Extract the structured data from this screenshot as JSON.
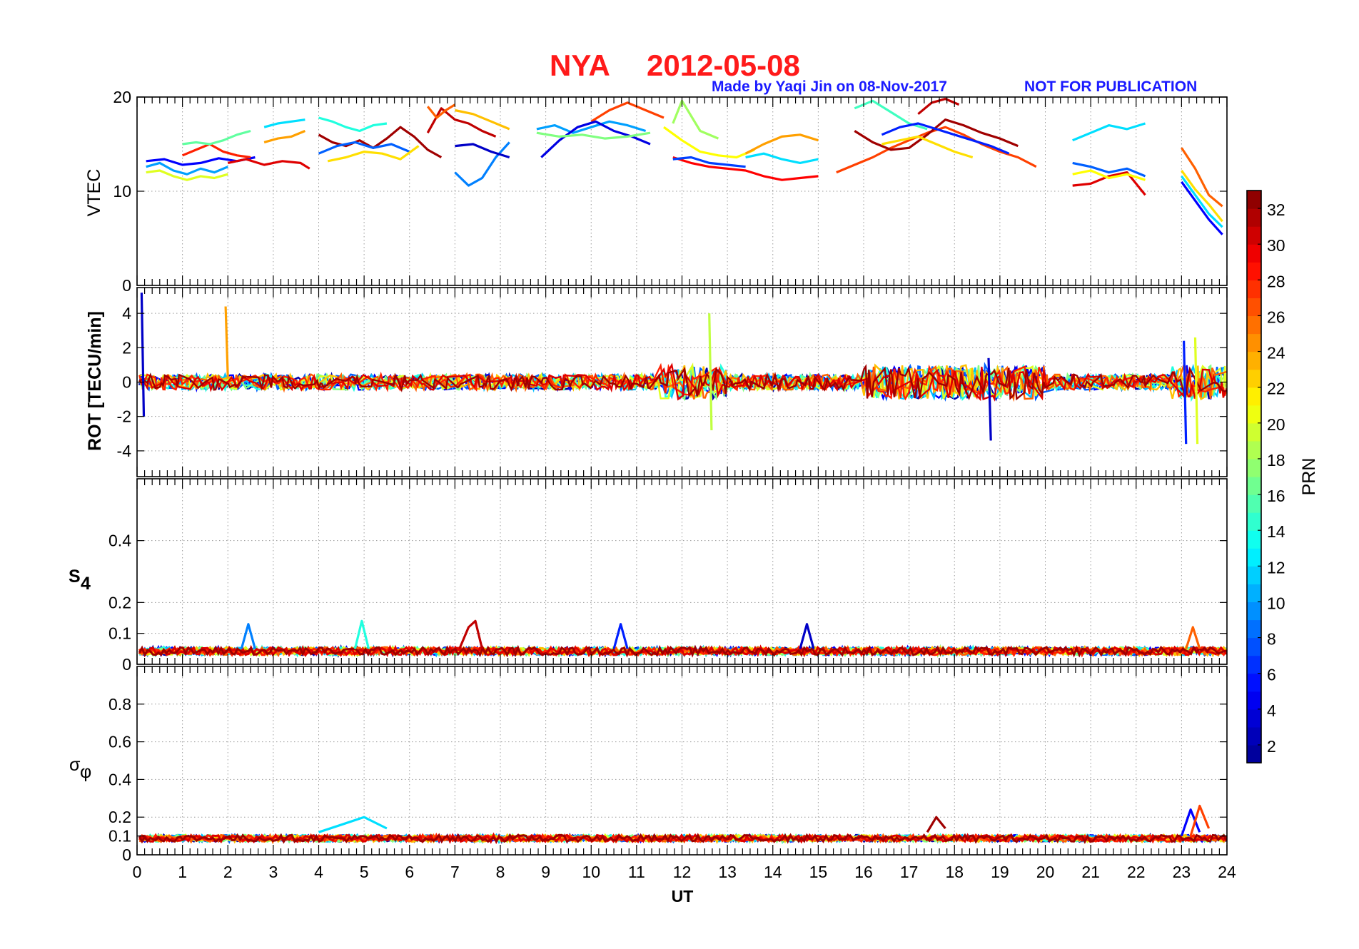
{
  "title": {
    "station": "NYA",
    "date": "2012-05-08"
  },
  "credit": {
    "made_by": "Made by Yaqi Jin on 08-Nov-2017",
    "notice": "NOT FOR PUBLICATION"
  },
  "xaxis": {
    "label": "UT",
    "range": [
      0,
      24
    ],
    "ticks": [
      "0",
      "1",
      "2",
      "3",
      "4",
      "5",
      "6",
      "7",
      "8",
      "9",
      "10",
      "11",
      "12",
      "13",
      "14",
      "15",
      "16",
      "17",
      "18",
      "19",
      "20",
      "21",
      "22",
      "23",
      "24"
    ]
  },
  "colorbar": {
    "label": "PRN",
    "range": [
      1,
      33
    ],
    "ticks": [
      "2",
      "4",
      "6",
      "8",
      "10",
      "12",
      "14",
      "16",
      "18",
      "20",
      "22",
      "24",
      "26",
      "28",
      "30",
      "32"
    ],
    "colormap": [
      "#00008f",
      "#0000ff",
      "#0080ff",
      "#00ffff",
      "#80ff80",
      "#ffff00",
      "#ff8000",
      "#ff0000",
      "#800000"
    ]
  },
  "chart_data": [
    {
      "type": "line",
      "panel": "VTEC",
      "ylabel": "VTEC",
      "ylim": [
        0,
        20
      ],
      "yticks": [
        "0",
        "10",
        "20"
      ],
      "grid": true,
      "series": [
        {
          "prn": 5,
          "x": [
            0.2,
            0.6,
            1.0,
            1.4,
            1.8,
            2.2,
            2.6
          ],
          "y": [
            13.2,
            13.4,
            12.8,
            13.0,
            13.5,
            13.2,
            13.6
          ]
        },
        {
          "prn": 10,
          "x": [
            0.2,
            0.5,
            0.8,
            1.1,
            1.4,
            1.7,
            2.0
          ],
          "y": [
            12.6,
            13.0,
            12.2,
            11.8,
            12.4,
            12.0,
            12.6
          ]
        },
        {
          "prn": 20,
          "x": [
            0.2,
            0.5,
            0.8,
            1.1,
            1.4,
            1.7,
            2.0
          ],
          "y": [
            12.0,
            12.2,
            11.6,
            11.2,
            11.6,
            11.4,
            11.8
          ]
        },
        {
          "prn": 28,
          "x": [
            1.0,
            1.3,
            1.6,
            1.9,
            2.2,
            2.5
          ],
          "y": [
            13.8,
            14.4,
            15.0,
            14.2,
            13.8,
            13.6
          ]
        },
        {
          "prn": 16,
          "x": [
            1.0,
            1.3,
            1.6,
            1.9,
            2.2,
            2.5
          ],
          "y": [
            15.0,
            15.2,
            15.0,
            15.4,
            16.0,
            16.4
          ]
        },
        {
          "prn": 30,
          "x": [
            2.0,
            2.4,
            2.8,
            3.2,
            3.6,
            3.8
          ],
          "y": [
            13.0,
            13.4,
            12.8,
            13.2,
            13.0,
            12.4
          ]
        },
        {
          "prn": 12,
          "x": [
            2.8,
            3.1,
            3.4,
            3.7
          ],
          "y": [
            16.8,
            17.2,
            17.4,
            17.6
          ]
        },
        {
          "prn": 24,
          "x": [
            2.8,
            3.1,
            3.4,
            3.7
          ],
          "y": [
            15.2,
            15.6,
            15.8,
            16.4
          ]
        },
        {
          "prn": 32,
          "x": [
            4.0,
            4.3,
            4.6,
            4.9,
            5.2,
            5.5,
            5.8,
            6.1,
            6.4,
            6.7
          ],
          "y": [
            16.0,
            15.2,
            14.8,
            15.4,
            14.6,
            15.6,
            16.8,
            15.8,
            14.4,
            13.6
          ]
        },
        {
          "prn": 14,
          "x": [
            4.0,
            4.3,
            4.6,
            4.9,
            5.2,
            5.5
          ],
          "y": [
            17.8,
            17.4,
            16.8,
            16.4,
            17.0,
            17.2
          ]
        },
        {
          "prn": 8,
          "x": [
            4.0,
            4.4,
            4.8,
            5.2,
            5.6,
            6.0
          ],
          "y": [
            14.0,
            14.8,
            15.2,
            14.6,
            15.0,
            14.2
          ]
        },
        {
          "prn": 22,
          "x": [
            4.2,
            4.6,
            5.0,
            5.4,
            5.8,
            6.2
          ],
          "y": [
            13.2,
            13.6,
            14.2,
            14.0,
            13.4,
            14.8
          ]
        },
        {
          "prn": 31,
          "x": [
            6.4,
            6.7,
            7.0,
            7.3,
            7.6,
            7.9
          ],
          "y": [
            16.2,
            18.8,
            17.6,
            17.2,
            16.4,
            15.8
          ]
        },
        {
          "prn": 26,
          "x": [
            6.4,
            6.6,
            6.8,
            7.0
          ],
          "y": [
            19.0,
            17.8,
            18.6,
            19.2
          ]
        },
        {
          "prn": 9,
          "x": [
            7.0,
            7.3,
            7.6,
            7.9,
            8.2
          ],
          "y": [
            12.0,
            10.6,
            11.4,
            13.6,
            15.2
          ]
        },
        {
          "prn": 3,
          "x": [
            7.0,
            7.4,
            7.8,
            8.2
          ],
          "y": [
            14.8,
            15.0,
            14.2,
            13.6
          ]
        },
        {
          "prn": 23,
          "x": [
            7.0,
            7.4,
            7.8,
            8.2
          ],
          "y": [
            18.6,
            18.2,
            17.4,
            16.6
          ]
        },
        {
          "prn": 10,
          "x": [
            8.8,
            9.2,
            9.6,
            10.0,
            10.4,
            10.8,
            11.2
          ],
          "y": [
            16.6,
            17.0,
            16.2,
            16.8,
            17.4,
            17.0,
            16.4
          ]
        },
        {
          "prn": 27,
          "x": [
            10.0,
            10.4,
            10.8,
            11.2,
            11.6
          ],
          "y": [
            17.4,
            18.6,
            19.4,
            18.6,
            17.8
          ]
        },
        {
          "prn": 4,
          "x": [
            8.9,
            9.3,
            9.7,
            10.1,
            10.5,
            10.9,
            11.3
          ],
          "y": [
            13.6,
            15.4,
            16.8,
            17.4,
            16.4,
            15.8,
            15.0
          ]
        },
        {
          "prn": 17,
          "x": [
            8.8,
            9.3,
            9.8,
            10.3,
            10.8,
            11.3
          ],
          "y": [
            16.2,
            15.8,
            16.0,
            15.6,
            15.8,
            16.2
          ]
        },
        {
          "prn": 21,
          "x": [
            11.6,
            12.0,
            12.4,
            12.8,
            13.2,
            13.6
          ],
          "y": [
            16.8,
            15.4,
            14.2,
            13.8,
            13.6,
            14.4
          ]
        },
        {
          "prn": 18,
          "x": [
            11.8,
            12.0,
            12.4,
            12.8
          ],
          "y": [
            17.2,
            19.6,
            16.4,
            15.6
          ]
        },
        {
          "prn": 29,
          "x": [
            11.8,
            12.2,
            12.6,
            13.0,
            13.4,
            13.8,
            14.2,
            14.6,
            15.0
          ],
          "y": [
            13.6,
            13.0,
            12.6,
            12.4,
            12.2,
            11.6,
            11.2,
            11.4,
            11.6
          ]
        },
        {
          "prn": 7,
          "x": [
            11.8,
            12.2,
            12.6,
            13.0,
            13.4
          ],
          "y": [
            13.4,
            13.6,
            13.0,
            12.8,
            12.6
          ]
        },
        {
          "prn": 24,
          "x": [
            13.4,
            13.8,
            14.2,
            14.6,
            15.0
          ],
          "y": [
            14.0,
            15.0,
            15.8,
            16.0,
            15.4
          ]
        },
        {
          "prn": 12,
          "x": [
            13.4,
            13.8,
            14.2,
            14.6,
            15.0
          ],
          "y": [
            13.6,
            14.0,
            13.4,
            13.0,
            13.4
          ]
        },
        {
          "prn": 27,
          "x": [
            15.4,
            15.8,
            16.2,
            16.6,
            17.0,
            17.4,
            17.8,
            18.2,
            18.6,
            19.0,
            19.4,
            19.8
          ],
          "y": [
            12.0,
            12.8,
            13.6,
            14.6,
            15.4,
            16.2,
            16.8,
            16.0,
            15.0,
            14.2,
            13.6,
            12.6
          ]
        },
        {
          "prn": 15,
          "x": [
            15.8,
            16.2,
            16.6,
            17.0,
            17.4
          ],
          "y": [
            18.8,
            19.6,
            18.4,
            17.2,
            16.6
          ]
        },
        {
          "prn": 32,
          "x": [
            15.8,
            16.2,
            16.6,
            17.0,
            17.4,
            17.8,
            18.2,
            18.6,
            19.0,
            19.4
          ],
          "y": [
            16.4,
            15.2,
            14.4,
            14.6,
            16.0,
            17.6,
            17.0,
            16.2,
            15.6,
            14.8
          ]
        },
        {
          "prn": 31,
          "x": [
            17.2,
            17.5,
            17.8,
            18.1
          ],
          "y": [
            18.2,
            19.4,
            19.8,
            19.2
          ]
        },
        {
          "prn": 6,
          "x": [
            16.4,
            16.8,
            17.2,
            17.6,
            18.0,
            18.4,
            18.8,
            19.2
          ],
          "y": [
            16.0,
            16.8,
            17.2,
            16.6,
            16.0,
            15.4,
            14.8,
            14.0
          ]
        },
        {
          "prn": 22,
          "x": [
            16.4,
            16.8,
            17.2,
            17.6,
            18.0,
            18.4
          ],
          "y": [
            15.0,
            15.4,
            15.8,
            15.0,
            14.2,
            13.6
          ]
        },
        {
          "prn": 12,
          "x": [
            20.6,
            21.0,
            21.4,
            21.8,
            22.2
          ],
          "y": [
            15.4,
            16.2,
            17.0,
            16.6,
            17.2
          ]
        },
        {
          "prn": 30,
          "x": [
            20.6,
            21.0,
            21.4,
            21.8,
            22.2
          ],
          "y": [
            10.6,
            10.8,
            11.6,
            12.0,
            9.6
          ]
        },
        {
          "prn": 8,
          "x": [
            20.6,
            21.0,
            21.4,
            21.8,
            22.2
          ],
          "y": [
            13.0,
            12.6,
            12.0,
            12.4,
            11.6
          ]
        },
        {
          "prn": 21,
          "x": [
            20.6,
            21.0,
            21.4,
            21.8,
            22.2
          ],
          "y": [
            11.8,
            12.2,
            11.4,
            11.8,
            11.2
          ]
        },
        {
          "prn": 5,
          "x": [
            23.0,
            23.3,
            23.6,
            23.9
          ],
          "y": [
            11.0,
            9.0,
            7.0,
            5.4
          ]
        },
        {
          "prn": 12,
          "x": [
            23.0,
            23.3,
            23.6,
            23.9
          ],
          "y": [
            11.6,
            9.6,
            7.6,
            6.2
          ]
        },
        {
          "prn": 22,
          "x": [
            23.0,
            23.3,
            23.6,
            23.9
          ],
          "y": [
            12.2,
            10.2,
            8.6,
            6.8
          ]
        },
        {
          "prn": 26,
          "x": [
            23.0,
            23.3,
            23.6,
            23.9
          ],
          "y": [
            14.6,
            12.4,
            9.6,
            8.4
          ]
        }
      ]
    },
    {
      "type": "line",
      "panel": "ROT",
      "ylabel": "ROT [TECU/min]",
      "ylim": [
        -5.5,
        5.5
      ],
      "yticks": [
        "-4",
        "-2",
        "0",
        "2",
        "4"
      ],
      "grid": true,
      "note": "high-frequency noise around 0 TECU/min with spikes",
      "series": [
        {
          "prn": 3,
          "x": [
            0.1,
            0.15
          ],
          "y": [
            5.2,
            -2.0
          ]
        },
        {
          "prn": 24,
          "x": [
            1.95,
            2.0
          ],
          "y": [
            4.4,
            0.2
          ]
        },
        {
          "prn": 19,
          "x": [
            12.6,
            12.65
          ],
          "y": [
            4.0,
            -2.8
          ]
        },
        {
          "prn": 3,
          "x": [
            18.75,
            18.8
          ],
          "y": [
            1.4,
            -3.4
          ]
        },
        {
          "prn": 6,
          "x": [
            23.05,
            23.1
          ],
          "y": [
            2.4,
            -3.6
          ]
        },
        {
          "prn": 20,
          "x": [
            23.3,
            23.35
          ],
          "y": [
            2.6,
            -3.6
          ]
        }
      ]
    },
    {
      "type": "line",
      "panel": "S4",
      "ylabel": "S4",
      "ylim": [
        0,
        0.6
      ],
      "yticks": [
        "0",
        "0.1",
        "0.2",
        "0.4"
      ],
      "grid": true,
      "series": [
        {
          "prn": 31,
          "x": [
            7.1,
            7.3,
            7.45,
            7.6
          ],
          "y": [
            0.05,
            0.12,
            0.14,
            0.05
          ]
        },
        {
          "prn": 9,
          "x": [
            2.3,
            2.45,
            2.6
          ],
          "y": [
            0.05,
            0.13,
            0.05
          ]
        },
        {
          "prn": 14,
          "x": [
            4.8,
            4.95,
            5.1
          ],
          "y": [
            0.05,
            0.14,
            0.05
          ]
        },
        {
          "prn": 6,
          "x": [
            10.5,
            10.65,
            10.8
          ],
          "y": [
            0.05,
            0.13,
            0.05
          ]
        },
        {
          "prn": 3,
          "x": [
            14.6,
            14.75,
            14.9
          ],
          "y": [
            0.05,
            0.13,
            0.05
          ]
        },
        {
          "prn": 26,
          "x": [
            23.1,
            23.25,
            23.4
          ],
          "y": [
            0.05,
            0.12,
            0.05
          ]
        }
      ]
    },
    {
      "type": "line",
      "panel": "sigma_phi",
      "ylabel": "σφ",
      "ylim": [
        0,
        1.0
      ],
      "yticks": [
        "0",
        "0.1",
        "0.2",
        "0.4",
        "0.6",
        "0.8"
      ],
      "grid": true,
      "series": [
        {
          "prn": 12,
          "x": [
            4.0,
            4.5,
            5.0,
            5.5
          ],
          "y": [
            0.12,
            0.16,
            0.2,
            0.14
          ]
        },
        {
          "prn": 5,
          "x": [
            23.0,
            23.2,
            23.4
          ],
          "y": [
            0.1,
            0.24,
            0.12
          ]
        },
        {
          "prn": 27,
          "x": [
            23.2,
            23.4,
            23.6
          ],
          "y": [
            0.1,
            0.26,
            0.14
          ]
        },
        {
          "prn": 32,
          "x": [
            17.4,
            17.6,
            17.8
          ],
          "y": [
            0.12,
            0.2,
            0.14
          ]
        }
      ]
    }
  ]
}
